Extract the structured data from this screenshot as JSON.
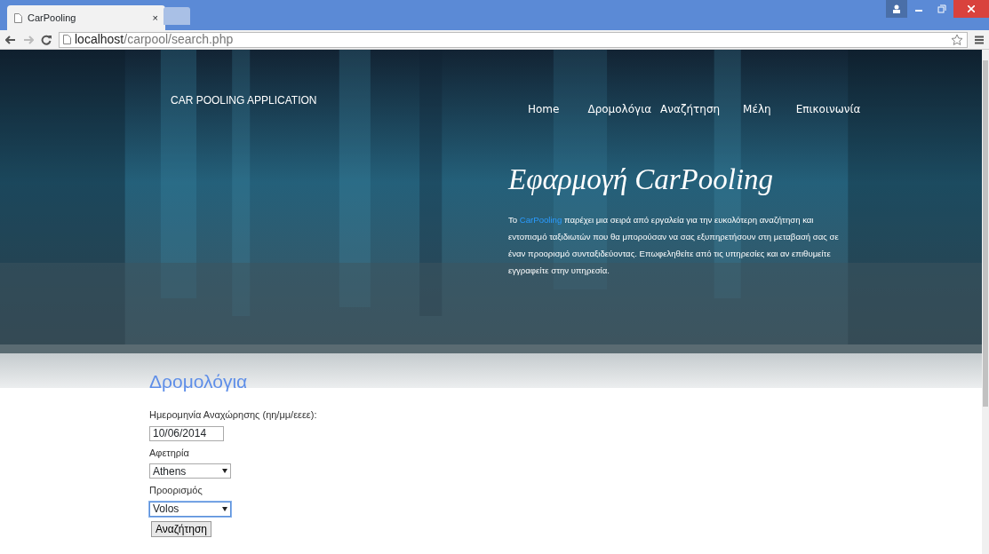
{
  "browser": {
    "tab_title": "CarPooling",
    "close": "×",
    "url_host": "localhost",
    "url_path": "/carpool/search.php"
  },
  "site": {
    "brand": "CAR POOLING APPLICATION",
    "nav": [
      {
        "label": "Home"
      },
      {
        "label": "Δρομολόγια"
      },
      {
        "label": "Αναζήτηση"
      },
      {
        "label": "Μέλη"
      },
      {
        "label": "Επικοινωνία"
      }
    ],
    "hero_title": "Εφαρμογή CarPooling",
    "intro": {
      "before": "Το ",
      "link": "CarPooling",
      "after": " παρέχει μια σειρά από εργαλεία για την ευκολότερη αναζήτηση και εντοπισμό ταξιδιωτών που θα μπορούσαν να σας εξυπηρετήσουν στη μεταβασή σας σε έναν προορισμό συνταξιδεύοντας. Επωφεληθείτε από τις υπηρεσίες και αν επιθυμείτε εγγραφείτε στην υπηρεσία."
    }
  },
  "form": {
    "heading": "Δρομολόγια",
    "fields": [
      {
        "kind": "text",
        "label": "Ημερομηνία Αναχώρησης (ηη/μμ/εεεε):",
        "value": "10/06/2014",
        "focused": false
      },
      {
        "kind": "select",
        "label": "Αφετηρία",
        "value": "Athens",
        "focused": false
      },
      {
        "kind": "select",
        "label": "Προορισμός",
        "value": "Volos",
        "focused": true
      }
    ],
    "button": "Αναζήτηση"
  }
}
